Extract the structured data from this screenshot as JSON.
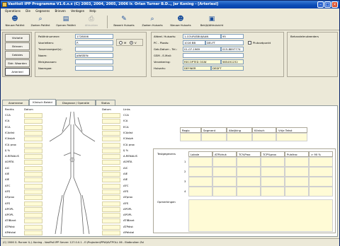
{
  "window": {
    "title": "Vasttoll IPP Programma V1.6.x.x (C) 2003, 2004, 2005, 2006 Ir. Orlan Turner B.D.., Jar Koning - [Arteriesl]"
  },
  "menu": [
    "Operations",
    "Die",
    "Gegevens",
    "Brieven",
    "Verdagen",
    "Help"
  ],
  "toolbar": [
    {
      "label": "Nieuwe Patiënt",
      "icon": "new-patient-icon"
    },
    {
      "label": "Zoeken Patiënt",
      "icon": "search-patient-icon"
    },
    {
      "label": "Openen Patiënt",
      "icon": "open-patient-icon"
    },
    {
      "label": "Afdrukken",
      "icon": "print-icon",
      "disabled": true
    },
    {
      "label": "Bewerk Huisarts",
      "icon": "edit-doctor-icon"
    },
    {
      "label": "Zoeken Huisarts",
      "icon": "search-doctor-icon"
    },
    {
      "label": "Nieuwe Huisarts",
      "icon": "new-doctor-icon"
    },
    {
      "label": "Bekijk/Afdrukzicht",
      "icon": "preview-icon"
    }
  ],
  "nav": [
    "Visitatie",
    "Brieven",
    "Gebbies",
    "Stdr. Waarden",
    "Arterieel"
  ],
  "patient": {
    "fields": [
      {
        "label": "Patiëntnummer:",
        "value": "1728006"
      },
      {
        "label": "Voorletters:",
        "value": "P."
      },
      {
        "label": "Tussenvoegsel(s):",
        "value": ""
      },
      {
        "label": "Naam:",
        "value": "JANSSEN"
      },
      {
        "label": "Meisjesnaam:",
        "value": ""
      },
      {
        "label": "Naamgoe:",
        "value": ""
      }
    ],
    "gender_m": "M",
    "gender_v": "V"
  },
  "info": {
    "rows": [
      {
        "label": "Afdeel. Huisarts:",
        "value": "1-COUR/SBUIJAAN",
        "extra": "95"
      },
      {
        "label": "PC - Plaats:",
        "value": "1016 BB",
        "extra": "DELFT"
      },
      {
        "label": "Geb.Datum - Tel.:",
        "value": "01-07-1969",
        "extra": "015-8897774"
      },
      {
        "label": "GSM - E-Mail:",
        "value": "",
        "extra": ""
      },
      {
        "label": "Verzekering:",
        "value": "RECOPTED OGW",
        "extra": "985491232"
      },
      {
        "label": "Huisarts:",
        "value": "DEFINER",
        "extra": "DEDFT"
      }
    ],
    "checkbox_label": "Plutovdpunkt"
  },
  "behandelmuteerders": "Behandelmuteerders",
  "tabs": [
    "Anamnese",
    "Klinisch Beleid",
    "Diagnose / Operatie",
    "Status"
  ],
  "arteries": {
    "headers": [
      "Rechts",
      "Datum",
      "Links"
    ],
    "left_labels": [
      "CCA",
      "ICA",
      "ECA",
      "ICAdist",
      "ICAsiph",
      "ICA prox",
      "IJ %",
      "A.RENALIS",
      "AORTA",
      "AIC",
      "AIE",
      "AIE",
      "AFC",
      "AFS",
      "AFprox",
      "AFS",
      "APOPL",
      "APOPL",
      "ATIBiant",
      "ATPdist",
      "APdistal"
    ],
    "right_labels": [
      "CCA",
      "ICA",
      "ECA",
      "ICAdist",
      "ICAsiph",
      "ICA prox",
      "IJ %",
      "A.RENALIS",
      "AORTA",
      "AIC",
      "AIE",
      "AIE",
      "AFC",
      "AFS",
      "AFprox",
      "AFS",
      "APOPL",
      "APOPL",
      "ATIBiant",
      "ATPdist",
      "APdistal"
    ]
  },
  "diagnose": {
    "title": "Diagnose",
    "columns": [
      "Regio",
      "Segment",
      "Afwijking",
      "Klinisch",
      "Vrije Tekst"
    ]
  },
  "behandeling": {
    "title": "Testgegevens",
    "columns": [
      "Lokale",
      "ATP/druk",
      "TC%Prox",
      "TCP%prox",
      "Pulsfrac",
      "> 90 %"
    ],
    "rows": [
      "1",
      "2",
      "3",
      "4"
    ],
    "opmerkingen": "Opmerkingen"
  },
  "status": "(C) 2006 G. Runner & J. Koning - VastPoll IPP Server: 127.0.0.1 - E:\\Projecten\\PPW\\AVTPOLL 06 - Ebdbruiken Zvl"
}
